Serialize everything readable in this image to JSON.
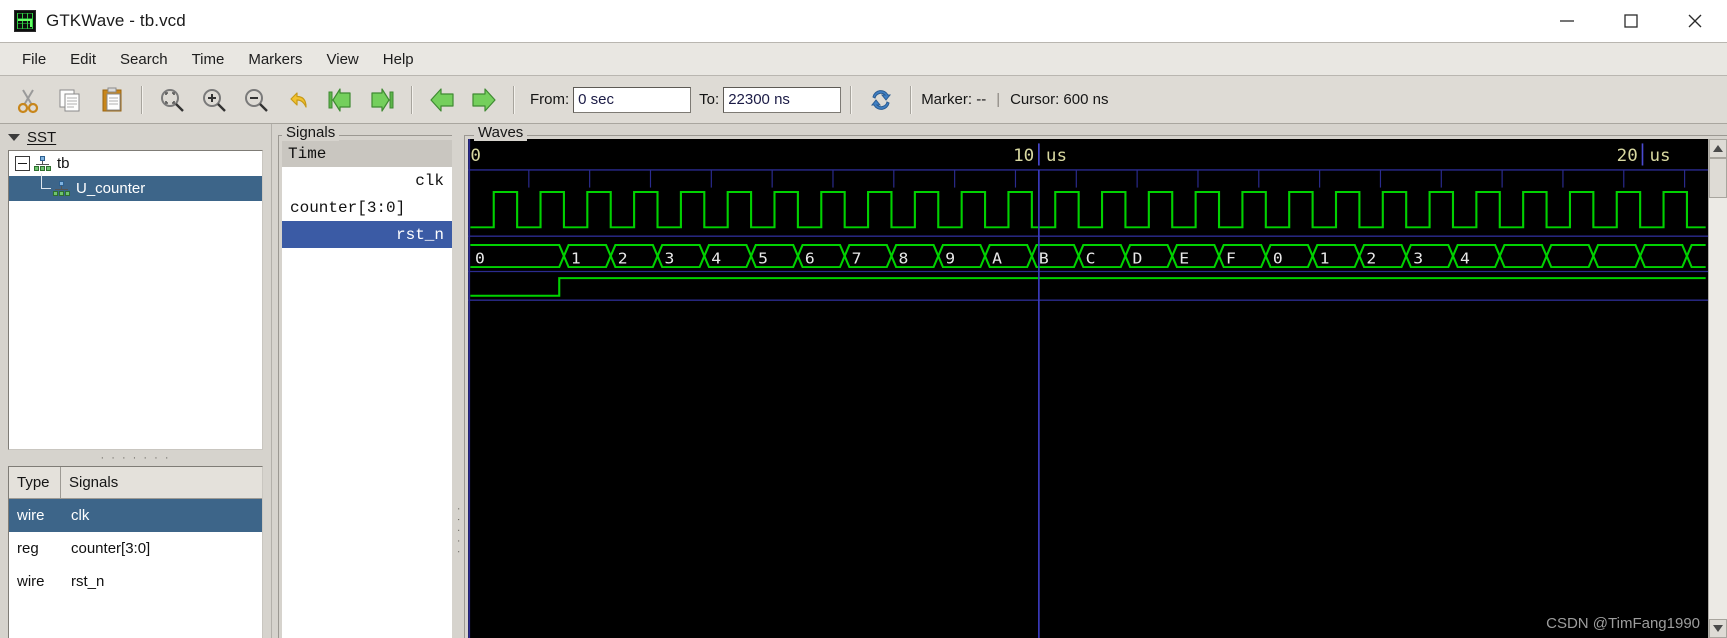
{
  "window": {
    "title": "GTKWave - tb.vcd",
    "app_icon": "gtkwave-icon",
    "minimize": "minimize-icon",
    "maximize": "maximize-icon",
    "close": "close-icon"
  },
  "menubar": {
    "items": [
      {
        "label": "File"
      },
      {
        "label": "Edit"
      },
      {
        "label": "Search"
      },
      {
        "label": "Time"
      },
      {
        "label": "Markers"
      },
      {
        "label": "View"
      },
      {
        "label": "Help"
      }
    ]
  },
  "toolbar": {
    "buttons": [
      {
        "name": "cut-icon"
      },
      {
        "name": "copy-icon"
      },
      {
        "name": "paste-icon"
      },
      {
        "name": "zoom-fit-icon"
      },
      {
        "name": "zoom-in-icon"
      },
      {
        "name": "zoom-out-icon"
      },
      {
        "name": "undo-icon"
      },
      {
        "name": "zoom-to-start-icon"
      },
      {
        "name": "zoom-to-end-icon"
      },
      {
        "name": "back-arrow-icon"
      },
      {
        "name": "forward-arrow-icon"
      },
      {
        "name": "reload-icon"
      }
    ],
    "from_label": "From:",
    "from_value": "0 sec",
    "to_label": "To:",
    "to_value": "22300 ns",
    "marker_text": "Marker: --",
    "separator": "|",
    "cursor_text": "Cursor: 600 ns"
  },
  "sst": {
    "header": "SST",
    "tree": [
      {
        "label": "tb",
        "selected": false
      },
      {
        "label": "U_counter",
        "selected": true
      }
    ]
  },
  "signals_table": {
    "columns": [
      "Type",
      "Signals"
    ],
    "rows": [
      {
        "type": "wire",
        "signal": "clk",
        "selected": true
      },
      {
        "type": "reg",
        "signal": "counter[3:0]",
        "selected": false
      },
      {
        "type": "wire",
        "signal": "rst_n",
        "selected": false
      }
    ]
  },
  "signals_pane": {
    "frame_label": "Signals",
    "time_header": "Time",
    "rows": [
      {
        "label": "clk",
        "align": "right",
        "selected": false
      },
      {
        "label": "counter[3:0]",
        "align": "left",
        "selected": false
      },
      {
        "label": "rst_n",
        "align": "right",
        "selected": true
      }
    ]
  },
  "waves": {
    "frame_label": "Waves",
    "watermark": "CSDN @TimFang1990",
    "colors": {
      "background": "#000000",
      "trace": "#00d200",
      "grid": "#2b2b8f",
      "marker": "#3b3bbf",
      "text": "#e8e8e8",
      "time_text": "#d8d8a0"
    },
    "ruler": {
      "start_label": "0",
      "ticks": [
        {
          "value": "10",
          "unit": "us"
        },
        {
          "value": "20",
          "unit": "us"
        }
      ]
    },
    "cursor_time": "600 ns"
  },
  "chart_data": {
    "type": "line",
    "title": "GTKWave waveform viewer - tb.vcd",
    "xlabel": "Time",
    "xlim": [
      0,
      22300
    ],
    "x_unit": "ns",
    "grid": true,
    "signals": [
      {
        "name": "clk",
        "type": "wire",
        "kind": "clock",
        "period_ns": 400,
        "duty": 0.5,
        "first_rise_ns": 200,
        "cycles_visible": 28
      },
      {
        "name": "counter[3:0]",
        "type": "reg",
        "kind": "bus",
        "radix": "hex",
        "transitions": [
          {
            "time_ns": 0,
            "value": "0"
          },
          {
            "time_ns": 1800,
            "value": "1"
          },
          {
            "time_ns": 2600,
            "value": "2"
          },
          {
            "time_ns": 3400,
            "value": "3"
          },
          {
            "time_ns": 4200,
            "value": "4"
          },
          {
            "time_ns": 5000,
            "value": "5"
          },
          {
            "time_ns": 5800,
            "value": "6"
          },
          {
            "time_ns": 6600,
            "value": "7"
          },
          {
            "time_ns": 7400,
            "value": "8"
          },
          {
            "time_ns": 8200,
            "value": "9"
          },
          {
            "time_ns": 9000,
            "value": "A"
          },
          {
            "time_ns": 9800,
            "value": "B"
          },
          {
            "time_ns": 10600,
            "value": "C"
          },
          {
            "time_ns": 11400,
            "value": "D"
          },
          {
            "time_ns": 12200,
            "value": "E"
          },
          {
            "time_ns": 13000,
            "value": "F"
          },
          {
            "time_ns": 13800,
            "value": "0"
          },
          {
            "time_ns": 14600,
            "value": "1"
          },
          {
            "time_ns": 15400,
            "value": "2"
          },
          {
            "time_ns": 16200,
            "value": "3"
          },
          {
            "time_ns": 17000,
            "value": "4"
          }
        ]
      },
      {
        "name": "rst_n",
        "type": "wire",
        "kind": "binary",
        "transitions": [
          {
            "time_ns": 0,
            "value": 0
          },
          {
            "time_ns": 1700,
            "value": 1
          }
        ]
      }
    ]
  }
}
